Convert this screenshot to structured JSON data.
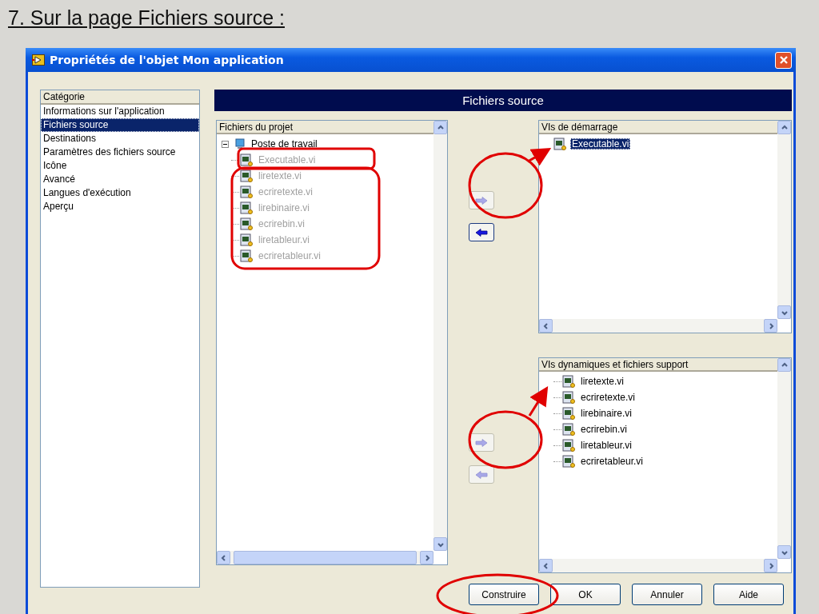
{
  "slide_title": "7. Sur la page Fichiers source :",
  "window": {
    "title": "Propriétés de l'objet Mon application"
  },
  "categories": {
    "header": "Catégorie",
    "items": [
      {
        "label": "Informations sur l'application",
        "selected": false
      },
      {
        "label": "Fichiers source",
        "selected": true
      },
      {
        "label": "Destinations",
        "selected": false
      },
      {
        "label": "Paramètres des fichiers source",
        "selected": false
      },
      {
        "label": "Icône",
        "selected": false
      },
      {
        "label": "Avancé",
        "selected": false
      },
      {
        "label": "Langues d'exécution",
        "selected": false
      },
      {
        "label": "Aperçu",
        "selected": false
      }
    ]
  },
  "section_title": "Fichiers source",
  "project_files": {
    "header": "Fichiers du projet",
    "root": {
      "label": "Poste de travail",
      "expanded": true,
      "children": [
        {
          "label": "Executable.vi",
          "disabled": true
        },
        {
          "label": "liretexte.vi",
          "disabled": true
        },
        {
          "label": "ecriretexte.vi",
          "disabled": true
        },
        {
          "label": "lirebinaire.vi",
          "disabled": true
        },
        {
          "label": "ecrirebin.vi",
          "disabled": true
        },
        {
          "label": "liretableur.vi",
          "disabled": true
        },
        {
          "label": "ecriretableur.vi",
          "disabled": true
        }
      ]
    }
  },
  "move_buttons_top": [
    {
      "kind": "add",
      "disabled": true
    },
    {
      "kind": "remove",
      "disabled": false
    }
  ],
  "startup_vis": {
    "header": "VIs de démarrage",
    "items": [
      {
        "label": "Executable.vi",
        "selected": true
      }
    ]
  },
  "move_buttons_bottom": [
    {
      "kind": "add",
      "disabled": true
    },
    {
      "kind": "remove",
      "disabled": true
    }
  ],
  "support_files": {
    "header": "VIs dynamiques et fichiers support",
    "items": [
      {
        "label": "liretexte.vi",
        "selected": false
      },
      {
        "label": "ecriretexte.vi",
        "selected": false
      },
      {
        "label": "lirebinaire.vi",
        "selected": false
      },
      {
        "label": "ecrirebin.vi",
        "selected": false
      },
      {
        "label": "liretableur.vi",
        "selected": false
      },
      {
        "label": "ecriretableur.vi",
        "selected": false
      }
    ]
  },
  "buttons": [
    {
      "label": "Construire"
    },
    {
      "label": "OK"
    },
    {
      "label": "Annuler"
    },
    {
      "label": "Aide"
    }
  ]
}
